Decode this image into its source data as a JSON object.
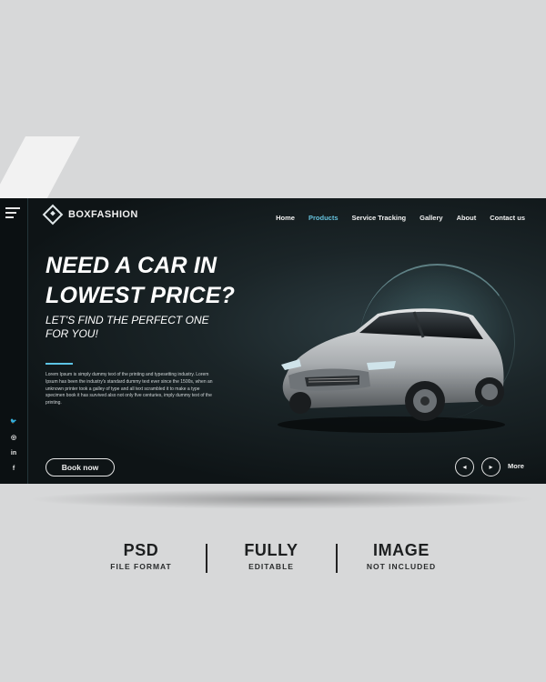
{
  "brand": {
    "name": "BOXFASHION"
  },
  "nav": {
    "items": [
      {
        "label": "Home",
        "active": false
      },
      {
        "label": "Products",
        "active": true
      },
      {
        "label": "Service Tracking",
        "active": false
      },
      {
        "label": "Gallery",
        "active": false
      },
      {
        "label": "About",
        "active": false
      },
      {
        "label": "Contact us",
        "active": false
      }
    ]
  },
  "hero": {
    "headline_line1": "NEED A CAR IN",
    "headline_line2": "LOWEST PRICE?",
    "subhead_line1": "LET'S FIND THE PERFECT ONE",
    "subhead_line2": "FOR YOU!",
    "description": "Lorem Ipsum is simply dummy text of the printing and typesetting industry. Lorem Ipsum has been the industry's standard dummy text ever since the 1500s, when an unknown printer took a galley of type and all text scrambled it to make a type specimen book it has survived also not only five centuries, imply dummy text of the printing.",
    "cta_label": "Book now",
    "more_label": "More",
    "prev_glyph": "◂",
    "next_glyph": "▸"
  },
  "social": {
    "icons": [
      "twitter-icon",
      "instagram-icon",
      "linkedin-icon",
      "facebook-icon"
    ],
    "glyphs": [
      "🐦",
      "◎",
      "in",
      "f"
    ]
  },
  "features": [
    {
      "title": "PSD",
      "subtitle": "FILE FORMAT"
    },
    {
      "title": "FULLY",
      "subtitle": "EDITABLE"
    },
    {
      "title": "IMAGE",
      "subtitle": "NOT INCLUDED"
    }
  ],
  "colors": {
    "accent": "#66c2dd",
    "panel": "#0e1416",
    "background": "#d7d8d9"
  }
}
